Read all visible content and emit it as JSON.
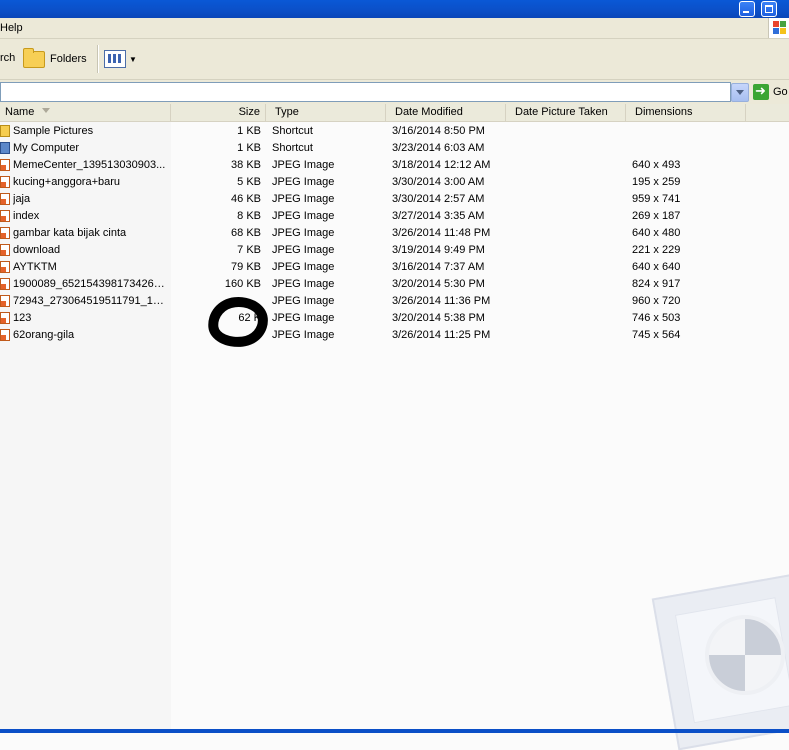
{
  "menubar": {
    "help": "Help"
  },
  "toolbar": {
    "search_fragment": "rch",
    "folders_label": "Folders"
  },
  "addressbar": {
    "go_label": "Go"
  },
  "columns": {
    "name": "Name",
    "size": "Size",
    "type": "Type",
    "date_modified": "Date Modified",
    "date_picture_taken": "Date Picture Taken",
    "dimensions": "Dimensions"
  },
  "files": [
    {
      "name": "Sample Pictures",
      "size": "1 KB",
      "type": "Shortcut",
      "date": "3/16/2014 8:50 PM",
      "dim": "",
      "icon": "folder-shortcut-icon"
    },
    {
      "name": "My Computer",
      "size": "1 KB",
      "type": "Shortcut",
      "date": "3/23/2014 6:03 AM",
      "dim": "",
      "icon": "computer-shortcut-icon"
    },
    {
      "name": "MemeCenter_139513030903...",
      "size": "38 KB",
      "type": "JPEG Image",
      "date": "3/18/2014 12:12 AM",
      "dim": "640 x 493",
      "icon": "jpeg-icon"
    },
    {
      "name": "kucing+anggora+baru",
      "size": "5 KB",
      "type": "JPEG Image",
      "date": "3/30/2014 3:00 AM",
      "dim": "195 x 259",
      "icon": "jpeg-icon"
    },
    {
      "name": "jaja",
      "size": "46 KB",
      "type": "JPEG Image",
      "date": "3/30/2014 2:57 AM",
      "dim": "959 x 741",
      "icon": "jpeg-icon"
    },
    {
      "name": "index",
      "size": "8 KB",
      "type": "JPEG Image",
      "date": "3/27/2014 3:35 AM",
      "dim": "269 x 187",
      "icon": "jpeg-icon"
    },
    {
      "name": "gambar kata bijak cinta",
      "size": "68 KB",
      "type": "JPEG Image",
      "date": "3/26/2014 11:48 PM",
      "dim": "640 x 480",
      "icon": "jpeg-icon"
    },
    {
      "name": "download",
      "size": "7 KB",
      "type": "JPEG Image",
      "date": "3/19/2014 9:49 PM",
      "dim": "221 x 229",
      "icon": "jpeg-icon"
    },
    {
      "name": "AYTKTM",
      "size": "79 KB",
      "type": "JPEG Image",
      "date": "3/16/2014 7:37 AM",
      "dim": "640 x 640",
      "icon": "jpeg-icon"
    },
    {
      "name": "1900089_652154398173426_...",
      "size": "160 KB",
      "type": "JPEG Image",
      "date": "3/20/2014 5:30 PM",
      "dim": "824 x 917",
      "icon": "jpeg-icon"
    },
    {
      "name": "72943_273064519511791_18...",
      "size": "",
      "type": "JPEG Image",
      "date": "3/26/2014 11:36 PM",
      "dim": "960 x 720",
      "icon": "jpeg-icon"
    },
    {
      "name": "123",
      "size": "62 K",
      "type": "JPEG Image",
      "date": "3/20/2014 5:38 PM",
      "dim": "746 x 503",
      "icon": "jpeg-icon"
    },
    {
      "name": "62orang-gila",
      "size": "",
      "type": "JPEG Image",
      "date": "3/26/2014 11:25 PM",
      "dim": "745 x 564",
      "icon": "jpeg-icon"
    }
  ]
}
